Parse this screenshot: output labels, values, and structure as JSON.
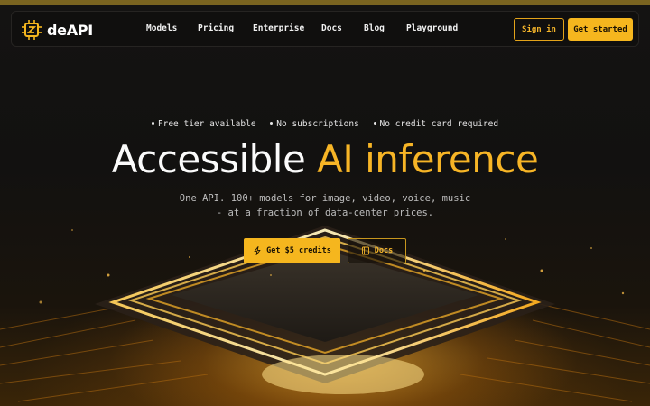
{
  "brand": {
    "name": "deAPI",
    "logo_icon": "chip-icon",
    "accent": "#f5b61e"
  },
  "nav": {
    "links": [
      "Models",
      "Pricing",
      "Enterprise",
      "Docs",
      "Blog",
      "Playground"
    ],
    "sign_in": "Sign in",
    "get_started": "Get started"
  },
  "hero": {
    "badges": [
      "Free tier available",
      "No subscriptions",
      "No credit card required"
    ],
    "headline_white": "Accessible",
    "headline_yellow": "AI inference",
    "subtitle_line1": "One API. 100+ models for image, video, voice, music",
    "subtitle_line2": "- at a fraction of data-center prices.",
    "cta_primary": {
      "label": "Get $5 credits",
      "icon": "lightning-icon"
    },
    "cta_secondary": {
      "label": "Docs",
      "icon": "book-icon"
    }
  }
}
